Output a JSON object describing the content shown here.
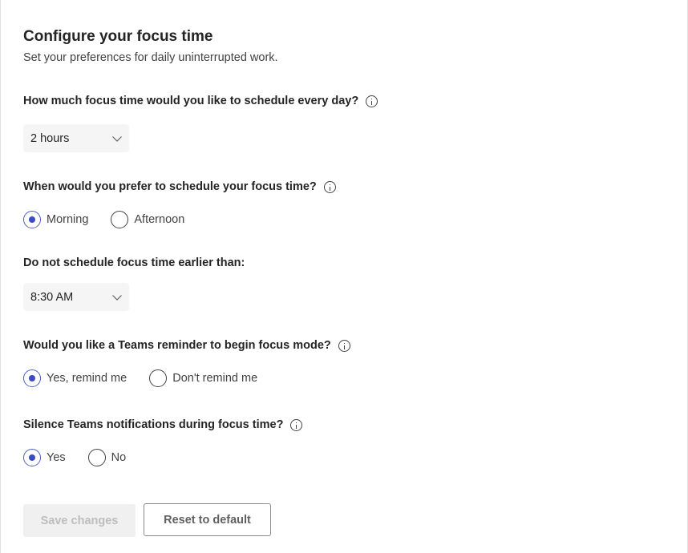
{
  "header": {
    "title": "Configure your focus time",
    "subtitle": "Set your preferences for daily uninterrupted work."
  },
  "daily_amount": {
    "question": "How much focus time would you like to schedule every day?",
    "selected": "2 hours"
  },
  "preferred_time": {
    "question": "When would you prefer to schedule your focus time?",
    "options": [
      "Morning",
      "Afternoon"
    ],
    "selected": "Morning"
  },
  "earliest_time": {
    "question": "Do not schedule focus time earlier than:",
    "selected": "8:30 AM"
  },
  "reminder": {
    "question": "Would you like a Teams reminder to begin focus mode?",
    "options": [
      "Yes, remind me",
      "Don't remind me"
    ],
    "selected": "Yes, remind me"
  },
  "silence": {
    "question": "Silence Teams notifications during focus time?",
    "options": [
      "Yes",
      "No"
    ],
    "selected": "Yes"
  },
  "actions": {
    "save_label": "Save changes",
    "reset_label": "Reset to default"
  },
  "colors": {
    "accent": "#3b4cc0",
    "disabled_bg": "#f0f0f0",
    "disabled_text": "#bdbdbd"
  }
}
